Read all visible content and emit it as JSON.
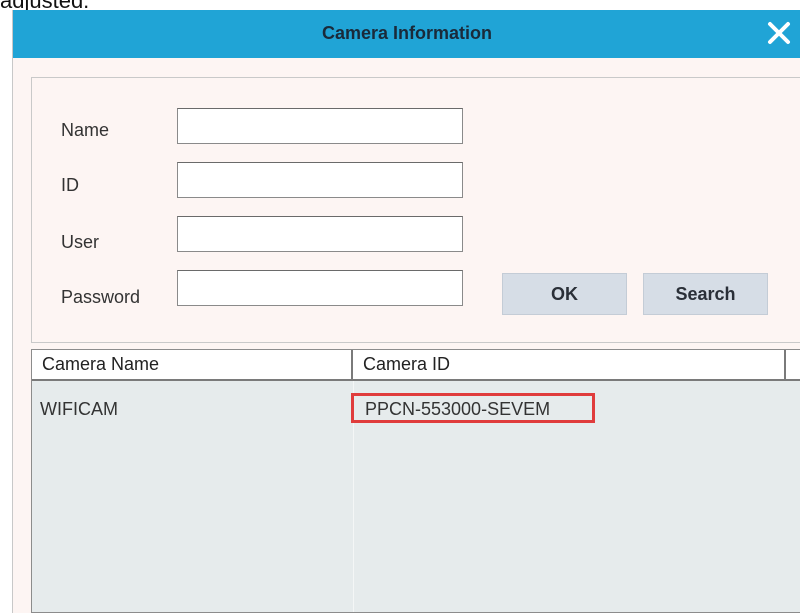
{
  "page_fragment_text": "adjusted.",
  "dialog": {
    "title": "Camera Information",
    "close_symbol": "×"
  },
  "form": {
    "name_label": "Name",
    "id_label": "ID",
    "user_label": "User",
    "password_label": "Password",
    "name_value": "",
    "id_value": "",
    "user_value": "",
    "password_value": "",
    "ok_label": "OK",
    "search_label": "Search"
  },
  "table": {
    "columns": [
      "Camera Name",
      "Camera ID"
    ],
    "rows": [
      {
        "camera_name": "WIFICAM",
        "camera_id": "PPCN-553000-SEVEM"
      }
    ]
  },
  "colors": {
    "titlebar": "#20a4d6",
    "highlight": "#e03c3c",
    "button": "#d6dde6"
  },
  "icons": {
    "close": "close-icon"
  }
}
